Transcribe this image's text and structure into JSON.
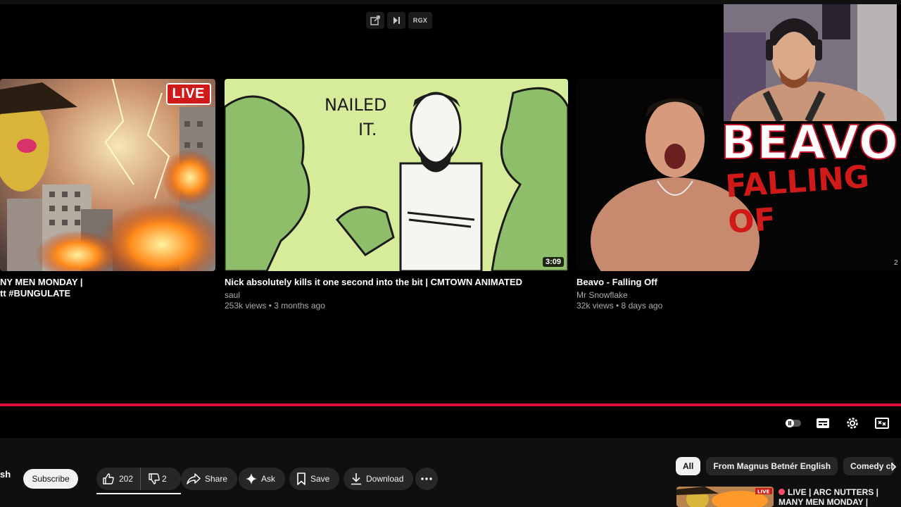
{
  "top_controls": {
    "rgx_label": "RGX"
  },
  "cards": [
    {
      "live_badge": "LIVE",
      "title_line1": "NY MEN MONDAY |",
      "title_line2": "tt #BUNGULATE"
    },
    {
      "thumb_text": "NAILED\nIT.",
      "duration": "3:09",
      "title": "Nick absolutely kills it one second into the bit | CMTOWN ANIMATED",
      "channel": "saul",
      "meta": "253k views • 3 months ago"
    },
    {
      "thumb_text_1": "BEAVO",
      "thumb_text_2": "FALLING OF",
      "chain_text": "BEAVO",
      "title": "Beavo - Falling Off",
      "channel": "Mr Snowflake",
      "meta": "32k views • 8 days ago",
      "edge_frag": "2"
    }
  ],
  "actions": {
    "channel_fragment": "sh",
    "subscribe": "Subscribe",
    "like_count": "202",
    "dislike_count": "2",
    "share": "Share",
    "ask": "Ask",
    "save": "Save",
    "download": "Download"
  },
  "chips": {
    "all": "All",
    "from": "From Magnus Betnér English",
    "comedy": "Comedy clu"
  },
  "recommendation": {
    "badge": "LIVE",
    "title": "LIVE | ARC NUTTERS | MANY MEN MONDAY |"
  },
  "colors": {
    "progress": "#e0103a",
    "live": "#d01a1a",
    "background": "#000000"
  }
}
